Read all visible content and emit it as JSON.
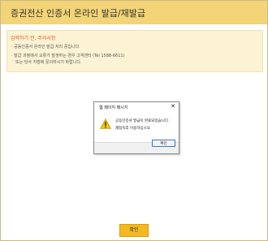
{
  "window": {
    "title": "증권전산 인증서 온라인 발급/재발급"
  },
  "notice": {
    "heading": "입력하기 전, 주의사항",
    "items": [
      "· 공동인증서 온라인 발급 처리 중입니다.",
      "· 발급 과정에서 오류가 발생하는 경우 고객센터 (Tel 1588-6611)",
      "또는 당사 지점에 문의하시기 바랍니다."
    ]
  },
  "dialog": {
    "title": "웹 페이지 메시지",
    "close_glyph": "✕",
    "icon": "warning-icon",
    "messages": [
      "공동인증서 발급이 완료되었습니다.",
      "재접속후 이용하십시요"
    ],
    "ok_label": "확인"
  },
  "footer": {
    "confirm_label": "확인"
  },
  "colors": {
    "title_bar": "#f3d476",
    "notice_bg": "#fcf3d5",
    "notice_heading": "#d85a23",
    "confirm_button": "#f4b921",
    "warning_icon": "#f5c400"
  }
}
